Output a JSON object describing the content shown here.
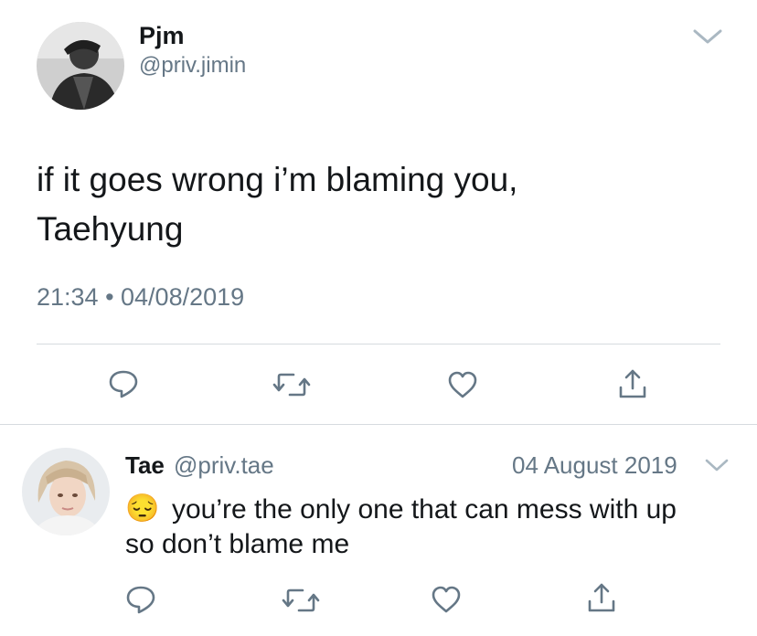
{
  "tweet": {
    "display_name": "Pjm",
    "handle": "@priv.jimin",
    "text_line1": "if it goes wrong i’m blaming you,",
    "text_line2": "Taehyung",
    "timestamp": "21:34 • 04/08/2019",
    "avatar_icon": "avatar-photo-icon",
    "actions": [
      "reply-icon",
      "retweet-icon",
      "like-icon",
      "share-icon"
    ]
  },
  "reply": {
    "display_name": "Tae",
    "handle": "@priv.tae",
    "date": "04 August 2019",
    "emoji": "😔",
    "text_line1": "you’re the only one that can mess with up",
    "text_line2": "so don’t blame me",
    "actions": [
      "reply-icon",
      "retweet-icon",
      "like-icon",
      "share-icon"
    ]
  },
  "colors": {
    "text": "#14171a",
    "secondary": "#657786",
    "divider": "#d6dbdf",
    "icon": "#657786"
  }
}
